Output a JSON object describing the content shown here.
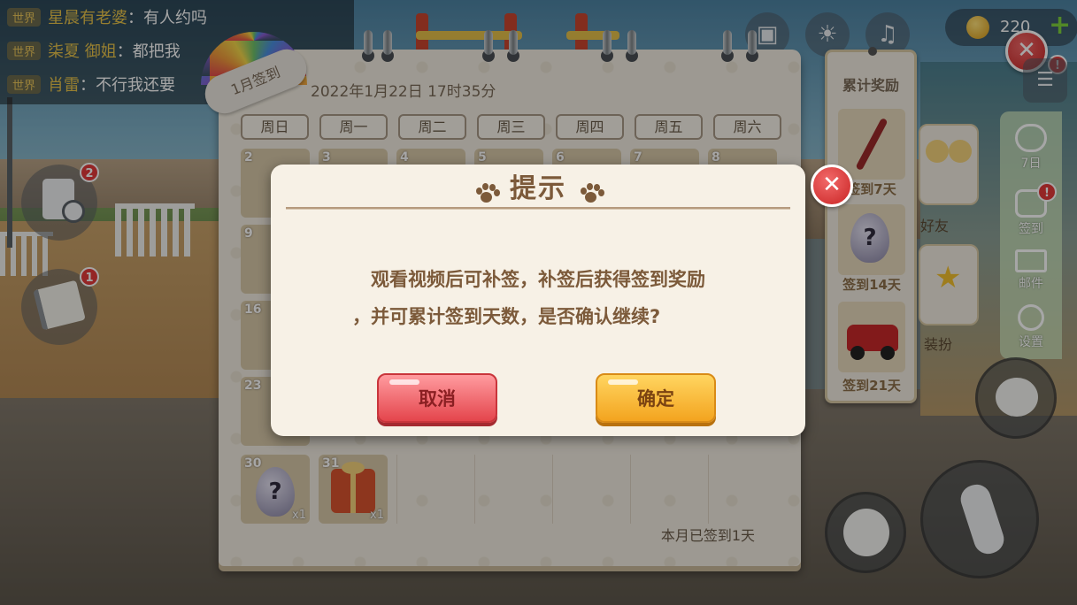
{
  "chat": [
    {
      "tag": "世界",
      "name": "星晨有老婆",
      "sep": "：",
      "text": "有人约吗"
    },
    {
      "tag": "世界",
      "name": "柒夏 御姐",
      "sep": "：",
      "text": "都把我"
    },
    {
      "tag": "世界",
      "name": "肖雷",
      "sep": "：",
      "text": "不行我还要"
    }
  ],
  "hud": {
    "coins": "220",
    "plus_label": "+",
    "close_label": "✕",
    "left_badges": [
      "2",
      "1"
    ],
    "alert_badge": "!"
  },
  "calendar": {
    "month_badge": "1月签到",
    "date_text": "2022年1月22日 17时35分",
    "weekdays": [
      "周日",
      "周一",
      "周二",
      "周三",
      "周四",
      "周五",
      "周六"
    ],
    "row1_days": [
      "2",
      "3",
      "4",
      "5",
      "6",
      "7",
      "8"
    ],
    "row2_days": [
      "9"
    ],
    "row3_days": [
      "16"
    ],
    "row4_days": [
      "23"
    ],
    "row5": [
      {
        "day": "30",
        "qty": "x1",
        "mark": "?"
      },
      {
        "day": "31",
        "qty": "x1"
      }
    ],
    "monthly_text": "本月已签到1天"
  },
  "rewards": {
    "title": "累计奖励",
    "items": [
      {
        "label": "签到7天"
      },
      {
        "label": "签到14天",
        "mark": "?"
      },
      {
        "label": "签到21天"
      }
    ]
  },
  "side_tiles": {
    "friends": "好友",
    "dress": "装扮"
  },
  "side_menu": [
    {
      "label": "7日"
    },
    {
      "label": "签到"
    },
    {
      "label": "邮件"
    },
    {
      "label": "设置"
    }
  ],
  "modal": {
    "title": "提示",
    "message_line1": "观看视频后可补签，补签后获得签到奖励",
    "message_line2": "，并可累计签到天数，是否确认继续?",
    "cancel_label": "取消",
    "confirm_label": "确定",
    "close_label": "✕"
  }
}
